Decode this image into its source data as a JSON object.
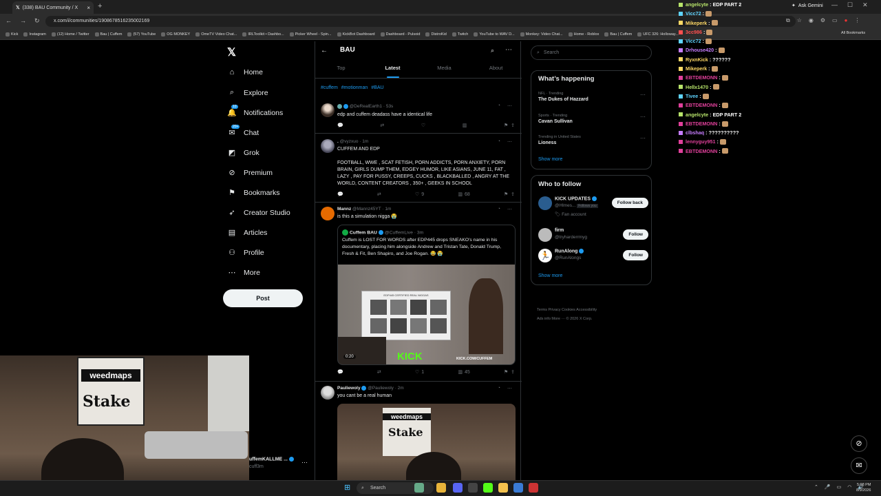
{
  "browser": {
    "tab_title": "(338) BAU Community / X",
    "tab_close": "×",
    "new_tab": "+",
    "url": "x.com/i/communities/1908678516235002169",
    "ask_gemini": "Ask Gemini",
    "all_bookmarks": "All Bookmarks",
    "bookmarks": [
      "Kick",
      "Instagram",
      "(12) Home / Twitter",
      "Bau | Cuffem",
      "(57) YouTube",
      "OG MONKEY",
      "OmeTV Video Chat...",
      "IRLToolkit • Dashbo...",
      "Picker Wheel - Spin...",
      "KickBot Dashboard",
      "Dashboard - Pulsoid",
      "DistroKid",
      "Twitch",
      "YouTube to WAV D...",
      "Monkey: Video Chat...",
      "Home - Roblox",
      "Bau | Cuffem",
      "UFC 326: Holloway..."
    ]
  },
  "nav": {
    "items": [
      {
        "label": "Home",
        "icon": "home-icon",
        "glyph": "⌂"
      },
      {
        "label": "Explore",
        "icon": "search-icon",
        "glyph": "⌕"
      },
      {
        "label": "Notifications",
        "icon": "bell-icon",
        "glyph": "🔔",
        "badge": "10"
      },
      {
        "label": "Chat",
        "icon": "chat-icon",
        "glyph": "✉",
        "badge": "20+"
      },
      {
        "label": "Grok",
        "icon": "grok-icon",
        "glyph": "◩"
      },
      {
        "label": "Premium",
        "icon": "premium-icon",
        "glyph": "⊘"
      },
      {
        "label": "Bookmarks",
        "icon": "bookmark-icon",
        "glyph": "⚑"
      },
      {
        "label": "Creator Studio",
        "icon": "rocket-icon",
        "glyph": "➶"
      },
      {
        "label": "Articles",
        "icon": "article-icon",
        "glyph": "▤"
      },
      {
        "label": "Profile",
        "icon": "profile-icon",
        "glyph": "⚇"
      },
      {
        "label": "More",
        "icon": "more-icon",
        "glyph": "⋯"
      }
    ],
    "post_label": "Post",
    "account_name": "uffemKALLME ...",
    "account_handle": "cuff3m"
  },
  "community": {
    "title": "BAU",
    "tabs": [
      "Top",
      "Latest",
      "Media",
      "About"
    ],
    "hashtags": [
      "#cuffem",
      "#motionman",
      "#BAU"
    ]
  },
  "tweets": [
    {
      "handle": "@DeRealEarth1 · 53s",
      "name": "",
      "text": "edp and cuffem deadass have a identical life",
      "reply": "",
      "retweet": "",
      "like": "",
      "views": ""
    },
    {
      "handle": "@vyzxuo · 1m",
      "name": ".",
      "text": "CUFFEM AND EDP",
      "text2": "FOOTBALL, WWE , SCAT FETISH, PORN ADDICTS, PORN ANXIETY, PORN BRAIN, GIRLS DUMP THEM, EDGEY HUMOR, LIKE ASIANS, JUNE 11, FAT , LAZY , PAY FOR PUSSY, CREEPS, CUCKS , BLACKBALLED , ANGRY AT THE WORLD, CONTENT CREATORS , 350+ ,  GEEKS IN SCHOOL",
      "like": "9",
      "views": "68"
    },
    {
      "handle": "@Mannz45YT · 1m",
      "name": "Mannz",
      "text": "is this a simulation nigga 😭",
      "like": "1",
      "views": "45",
      "quote": {
        "name": "Cuffem BAU",
        "handle": "@CuffemLive · 3m",
        "text": "Cuffem is LOST FOR WORDS after EDP445 drops SNEAKO's name in his documentary, placing him alongside Andrew and Tristan Tate, Donald Trump, Fresh & Fit, Ben Shapiro, and Joe Rogan. 😂 😭",
        "video_time": "0:20",
        "board_title": "EDP445 CERTIFIED REAL NIGGAS",
        "kick": "KICK",
        "kick_url": "KICK.COM/CUFFEM"
      }
    },
    {
      "handle": "@Pauliewoly · 2m",
      "name": "Pauliewoly",
      "text": "you cant be a real human"
    }
  ],
  "right": {
    "search_placeholder": "Search",
    "happening_title": "What’s happening",
    "trends": [
      {
        "cat": "NFL · Trending",
        "name": "The Dukes of Hazzard"
      },
      {
        "cat": "Sports · Trending",
        "name": "Cavan Sullivan"
      },
      {
        "cat": "Trending in United States",
        "name": "Lioness"
      }
    ],
    "show_more": "Show more",
    "follow_title": "Who to follow",
    "who": [
      {
        "name": "KICK UPDATES",
        "handle": "@Hlmes...",
        "follows_you": "Follows you",
        "sub": "Fan account",
        "btn": "Follow back"
      },
      {
        "name": "firm",
        "handle": "@tryharderrmyg",
        "btn": "Follow"
      },
      {
        "name": "RunAlong",
        "handle": "@RunAlongs",
        "btn": "Follow"
      }
    ],
    "show_more2": "Show more",
    "footer1": "Terms   Privacy   Cookies   Accessibility",
    "footer2": "Ads info   More ···   © 2026 X Corp."
  },
  "chat": [
    {
      "user": "angelcyte",
      "color": "#b7e36a",
      "msg": "EDP PART 2",
      "emote": false
    },
    {
      "user": "Vicc72",
      "color": "#5fd4ff",
      "msg": "",
      "emote": true
    },
    {
      "user": "Mikeperk",
      "color": "#ffd966",
      "msg": "",
      "emote": true
    },
    {
      "user": "3cc986",
      "color": "#ff5050",
      "msg": "",
      "emote": true
    },
    {
      "user": "Vicc72",
      "color": "#5fd4ff",
      "msg": "",
      "emote": true
    },
    {
      "user": "Drhouse420",
      "color": "#c77dff",
      "msg": "",
      "emote": true
    },
    {
      "user": "RyxnKick",
      "color": "#ffd966",
      "msg": "??????",
      "emote": false
    },
    {
      "user": "Mikeperk",
      "color": "#ffd966",
      "msg": "",
      "emote": true
    },
    {
      "user": "EBTDEMONN",
      "color": "#e0409b",
      "msg": "",
      "emote": true
    },
    {
      "user": "Hellx1470",
      "color": "#b7e36a",
      "msg": "",
      "emote": true
    },
    {
      "user": "Tivee",
      "color": "#5fd4ff",
      "msg": "",
      "emote": true
    },
    {
      "user": "EBTDEMONN",
      "color": "#e0409b",
      "msg": "",
      "emote": true
    },
    {
      "user": "angelcyte",
      "color": "#b7e36a",
      "msg": "EDP PART 2",
      "emote": false
    },
    {
      "user": "EBTDEMONN",
      "color": "#e0409b",
      "msg": "",
      "emote": true
    },
    {
      "user": "clbshaq",
      "color": "#c77dff",
      "msg": "??????????",
      "emote": false
    },
    {
      "user": "lennyguy951",
      "color": "#e0409b",
      "msg": "",
      "emote": true
    },
    {
      "user": "EBTDEMONN",
      "color": "#e0409b",
      "msg": "",
      "emote": true
    }
  ],
  "cam": {
    "banner_top": "weedmaps",
    "banner_main": "Stake"
  },
  "taskbar": {
    "search": "Search",
    "time": "5:08 PM",
    "date": "8/9/2026"
  },
  "colors": {
    "accent": "#1d9bf0",
    "kick_green": "#53fc18"
  }
}
